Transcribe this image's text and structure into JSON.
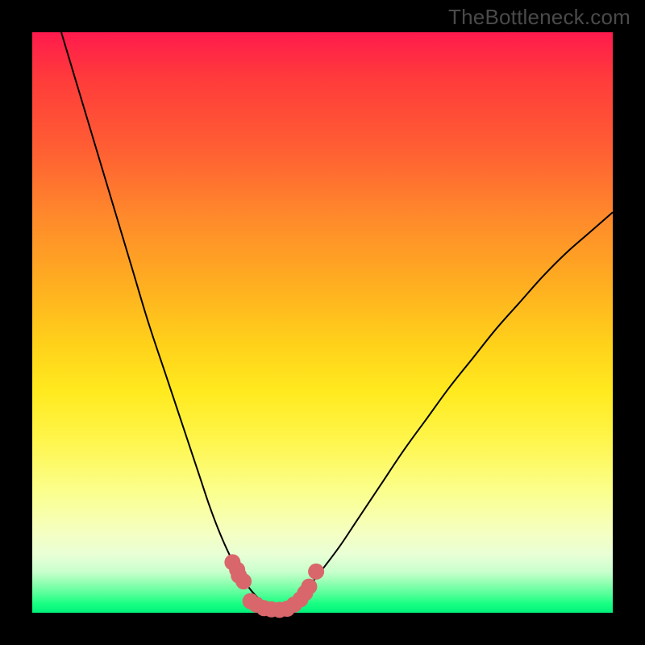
{
  "watermark": "TheBottleneck.com",
  "colors": {
    "frame": "#000000",
    "curve": "#000000",
    "dot": "#d9666b",
    "gradient_top": "#ff1a4d",
    "gradient_bottom": "#00f07a"
  },
  "chart_data": {
    "type": "line",
    "title": "",
    "xlabel": "",
    "ylabel": "",
    "xlim": [
      0,
      100
    ],
    "ylim": [
      0,
      100
    ],
    "series": [
      {
        "name": "left-curve",
        "x": [
          5,
          8,
          11,
          14,
          17,
          20,
          23,
          25,
          27,
          29,
          30.5,
          32,
          33.5,
          35,
          36.5,
          38,
          39.5,
          41,
          42.5
        ],
        "values": [
          100,
          90,
          80,
          70,
          60,
          50,
          41,
          35,
          29,
          23,
          18.5,
          14.5,
          11,
          8,
          5.5,
          3.5,
          2,
          1,
          0.5
        ]
      },
      {
        "name": "right-curve",
        "x": [
          42.5,
          44,
          46,
          48,
          50,
          53,
          56,
          60,
          64,
          68,
          72,
          76,
          80,
          84,
          88,
          92,
          96,
          100
        ],
        "values": [
          0.5,
          1.5,
          3,
          5,
          7.5,
          11.5,
          16,
          22,
          28,
          33.5,
          39,
          44,
          49,
          53.5,
          58,
          62,
          65.5,
          69
        ]
      }
    ],
    "points": [
      {
        "name": "dot",
        "x": 34.5,
        "y": 8.7
      },
      {
        "name": "dot",
        "x": 35.3,
        "y": 7.4
      },
      {
        "name": "dot",
        "x": 35.6,
        "y": 6.4
      },
      {
        "name": "dot",
        "x": 36.4,
        "y": 5.4
      },
      {
        "name": "dot",
        "x": 37.6,
        "y": 2.0
      },
      {
        "name": "dot",
        "x": 38.6,
        "y": 1.4
      },
      {
        "name": "dot",
        "x": 39.9,
        "y": 0.8
      },
      {
        "name": "dot",
        "x": 41.2,
        "y": 0.6
      },
      {
        "name": "dot",
        "x": 42.6,
        "y": 0.5
      },
      {
        "name": "dot",
        "x": 43.9,
        "y": 0.7
      },
      {
        "name": "dot",
        "x": 45.1,
        "y": 1.4
      },
      {
        "name": "dot",
        "x": 46.2,
        "y": 2.3
      },
      {
        "name": "dot",
        "x": 47.0,
        "y": 3.4
      },
      {
        "name": "dot",
        "x": 47.7,
        "y": 4.5
      },
      {
        "name": "dot",
        "x": 48.9,
        "y": 7.1
      }
    ],
    "dot_radius_px": 10
  }
}
